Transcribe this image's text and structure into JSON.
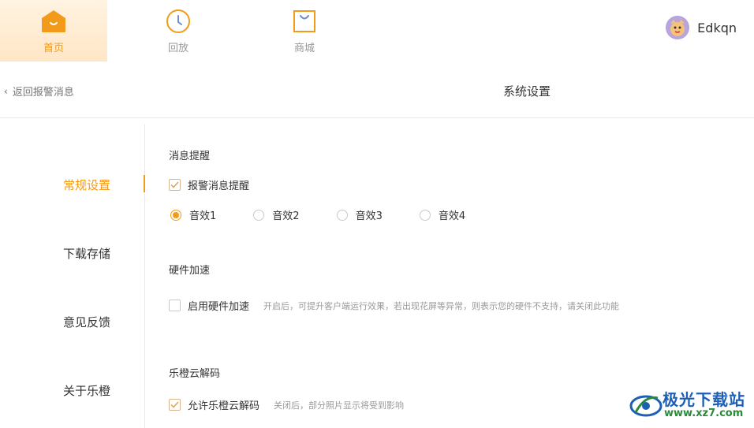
{
  "nav": {
    "items": [
      {
        "label": "首页",
        "icon": "home-icon",
        "active": true
      },
      {
        "label": "回放",
        "icon": "clock-icon",
        "active": false
      },
      {
        "label": "商城",
        "icon": "shopping-bag-icon",
        "active": false
      }
    ]
  },
  "user": {
    "name": "Edkqn",
    "avatar_icon": "cartoon-avatar-icon"
  },
  "subbar": {
    "back_label": "返回报警消息",
    "title": "系统设置"
  },
  "sidebar": {
    "items": [
      "常规设置",
      "下载存储",
      "意见反馈",
      "关于乐橙"
    ],
    "active_index": 0
  },
  "settings": {
    "message": {
      "title": "消息提醒",
      "alarm_label": "报警消息提醒",
      "alarm_checked": true,
      "sounds": [
        "音效1",
        "音效2",
        "音效3",
        "音效4"
      ],
      "selected_sound": 0
    },
    "hardware": {
      "title": "硬件加速",
      "enable_label": "启用硬件加速",
      "enable_checked": false,
      "description": "开启后，可提升客户端运行效果，若出现花屏等异常，则表示您的硬件不支持，请关闭此功能"
    },
    "cloud": {
      "title": "乐橙云解码",
      "allow_label": "允许乐橙云解码",
      "allow_checked": true,
      "description": "关闭后，部分照片显示将受到影响"
    }
  },
  "watermark": {
    "text": "极光下载站",
    "url": "www.xz7.com"
  },
  "colors": {
    "accent": "#f29a1a",
    "nav_active_bg": "#ffe6c6",
    "watermark_blue": "#1c5fb5",
    "watermark_green": "#2a8a3a"
  }
}
